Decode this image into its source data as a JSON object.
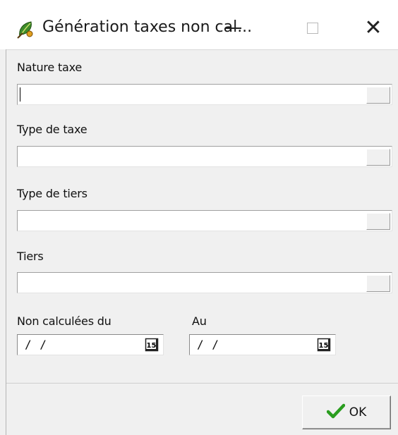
{
  "window": {
    "title": "Génération taxes non cal...",
    "controls": {
      "minimize": "—",
      "close": "✕"
    }
  },
  "form": {
    "nature_taxe": {
      "label": "Nature taxe",
      "value": ""
    },
    "type_taxe": {
      "label": "Type de taxe",
      "value": ""
    },
    "type_tiers": {
      "label": "Type de tiers",
      "value": ""
    },
    "tiers": {
      "label": "Tiers",
      "value": ""
    },
    "date_from": {
      "label": "Non calculées du",
      "value": "/ /",
      "icon_text": "15"
    },
    "date_to": {
      "label": "Au",
      "value": "/ /",
      "icon_text": "15"
    }
  },
  "buttons": {
    "ok_label": "OK"
  },
  "icons": {
    "app": "app-leaf-icon",
    "dropdown": "dropdown-button",
    "calendar": "calendar-icon",
    "check": "checkmark-icon"
  },
  "colors": {
    "background": "#f0f0f0",
    "checkmark": "#2a9d1f"
  }
}
